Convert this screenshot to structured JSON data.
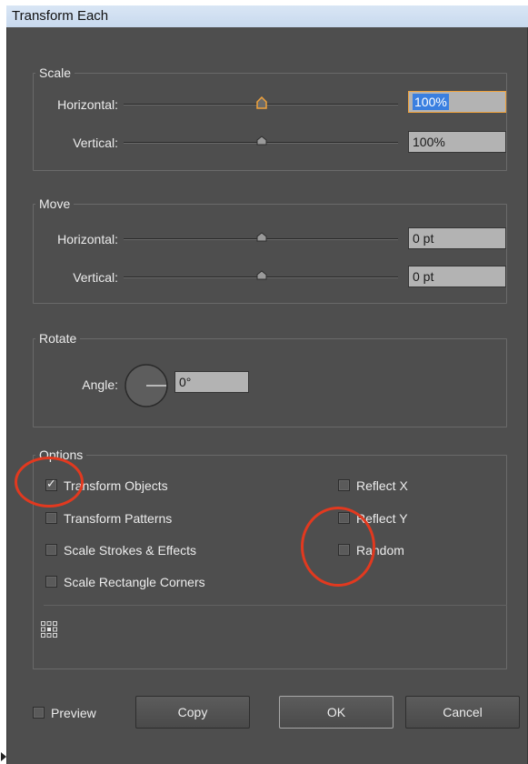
{
  "window": {
    "title": "Transform Each"
  },
  "scale": {
    "legend": "Scale",
    "horizontal_label": "Horizontal:",
    "horizontal_value": "100%",
    "vertical_label": "Vertical:",
    "vertical_value": "100%"
  },
  "move": {
    "legend": "Move",
    "horizontal_label": "Horizontal:",
    "horizontal_value": "0 pt",
    "vertical_label": "Vertical:",
    "vertical_value": "0 pt"
  },
  "rotate": {
    "legend": "Rotate",
    "angle_label": "Angle:",
    "angle_value": "0°"
  },
  "options": {
    "legend": "Options",
    "transform_objects": {
      "label": "Transform Objects",
      "checked": true
    },
    "transform_patterns": {
      "label": "Transform Patterns",
      "checked": false
    },
    "scale_strokes": {
      "label": "Scale Strokes & Effects",
      "checked": false
    },
    "scale_rect_corners": {
      "label": "Scale Rectangle Corners",
      "checked": false
    },
    "reflect_x": {
      "label": "Reflect X",
      "checked": false
    },
    "reflect_y": {
      "label": "Reflect Y",
      "checked": false
    },
    "random": {
      "label": "Random",
      "checked": false
    },
    "reference_point_icon": "reference-point-grid-icon"
  },
  "footer": {
    "preview_label": "Preview",
    "copy_label": "Copy",
    "ok_label": "OK",
    "cancel_label": "Cancel"
  },
  "colors": {
    "panel_bg": "#4e4e4e",
    "field_bg": "#b3b3b3",
    "focus_border": "#f0a23b",
    "selection": "#3a7fe0",
    "annotation_circle": "#e2391f"
  }
}
